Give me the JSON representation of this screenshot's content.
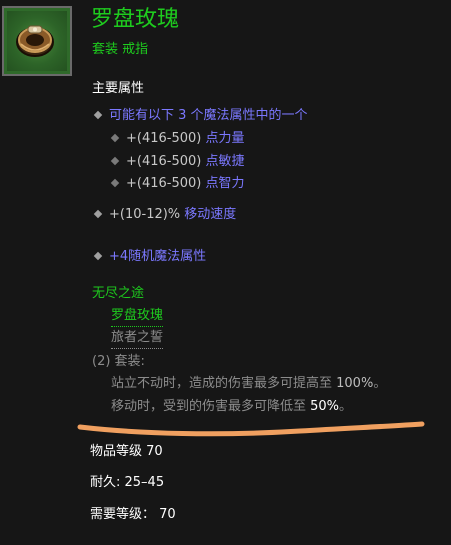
{
  "item": {
    "name": "罗盘玫瑰",
    "type": "套装 戒指",
    "colors": {
      "set_green": "#1ecb1e",
      "magic_blue": "#7b78ff",
      "annotation_orange": "#f0a060"
    }
  },
  "primary": {
    "heading": "主要属性",
    "choose_line": "可能有以下 3 个魔法属性中的一个",
    "choices": [
      {
        "prefix": "+(416-500) ",
        "suffix": "点力量"
      },
      {
        "prefix": "+(416-500) ",
        "suffix": "点敏捷"
      },
      {
        "prefix": "+(416-500) ",
        "suffix": "点智力"
      }
    ],
    "move_prefix": "+(10-12)% ",
    "move_suffix": "移动速度",
    "random_magic": "+4随机魔法属性"
  },
  "set": {
    "name": "无尽之途",
    "items": [
      "罗盘玫瑰",
      "旅者之誓"
    ],
    "bonus_label": "(2) 套装:",
    "bonus_1_pre": "站立不动时，造成的伤害最多可提高至 ",
    "bonus_1_val": "100%",
    "bonus_1_post": "。",
    "bonus_2_pre": "移动时，受到的伤害最多可降低至 ",
    "bonus_2_val": "50%",
    "bonus_2_post": "。"
  },
  "footer": {
    "item_level": "物品等级 70",
    "durability": "耐久: 25–45",
    "required_level": "需要等级： 70"
  },
  "icons": {
    "item_icon": "ring-icon",
    "bullet": "diamond-bullet-icon"
  }
}
